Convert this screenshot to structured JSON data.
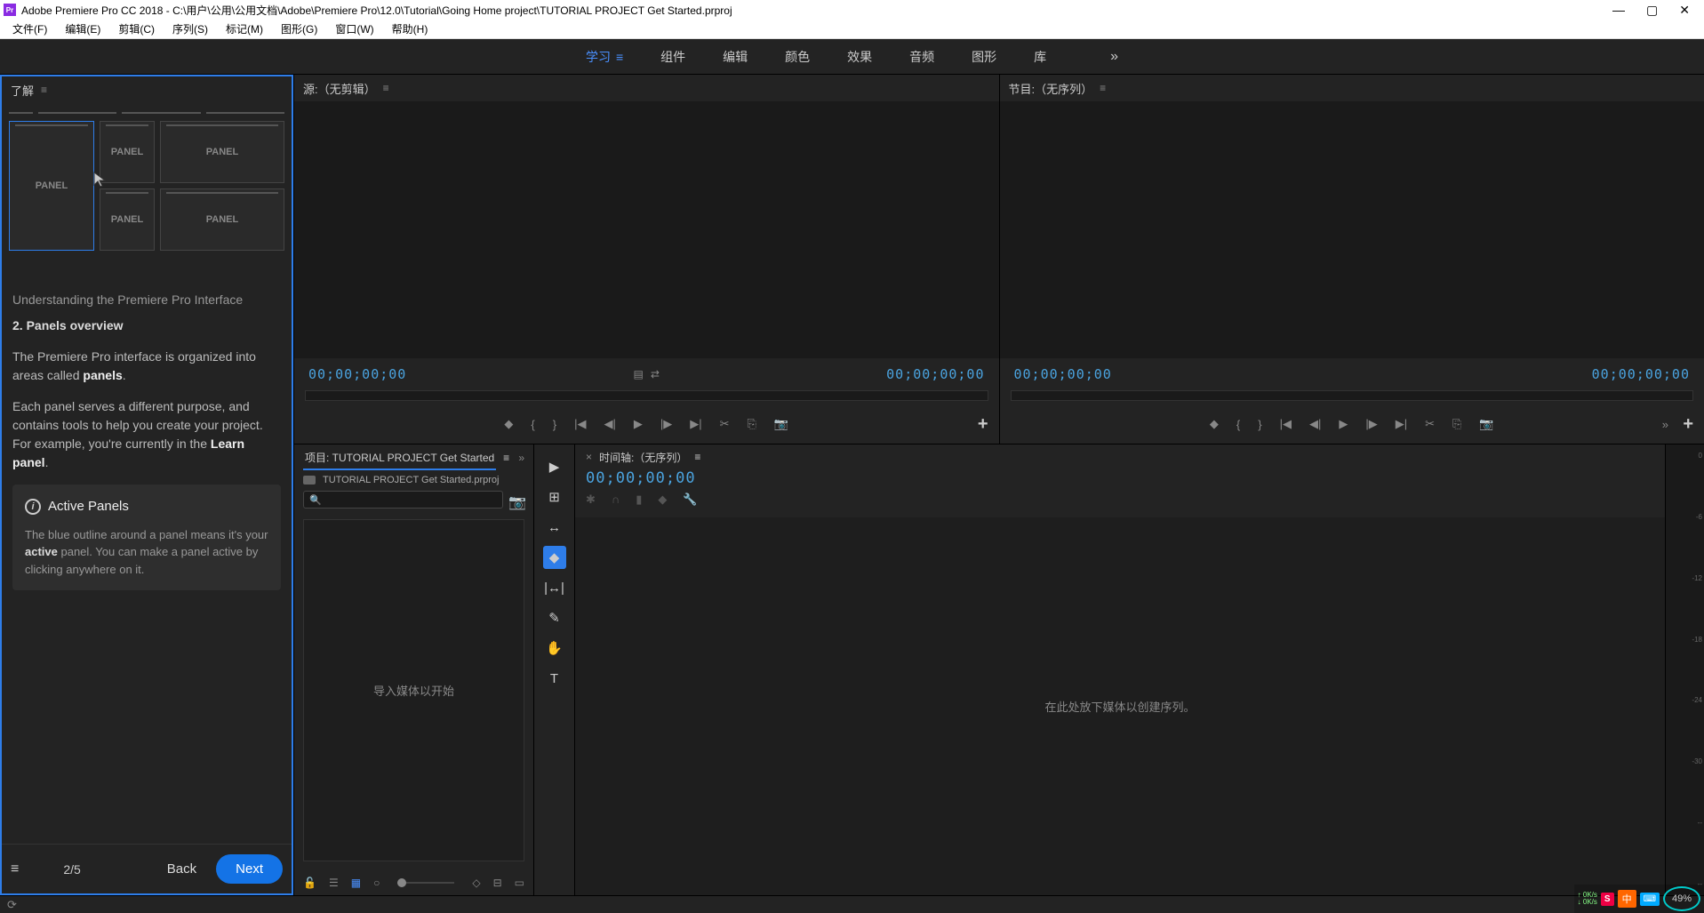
{
  "titlebar": {
    "app_icon_text": "Pr",
    "title": "Adobe Premiere Pro CC 2018 - C:\\用户\\公用\\公用文档\\Adobe\\Premiere Pro\\12.0\\Tutorial\\Going Home project\\TUTORIAL PROJECT Get Started.prproj",
    "minimize": "—",
    "maximize": "▢",
    "close": "✕"
  },
  "menubar": {
    "items": [
      "文件(F)",
      "编辑(E)",
      "剪辑(C)",
      "序列(S)",
      "标记(M)",
      "图形(G)",
      "窗口(W)",
      "帮助(H)"
    ]
  },
  "workspaces": {
    "items": [
      {
        "label": "学习",
        "active": true
      },
      {
        "label": "组件",
        "active": false
      },
      {
        "label": "编辑",
        "active": false
      },
      {
        "label": "颜色",
        "active": false
      },
      {
        "label": "效果",
        "active": false
      },
      {
        "label": "音频",
        "active": false
      },
      {
        "label": "图形",
        "active": false
      },
      {
        "label": "库",
        "active": false
      }
    ],
    "overflow": "»"
  },
  "learn": {
    "tab_title": "了解",
    "thumbs": [
      "PANEL",
      "PANEL",
      "PANEL",
      "PANEL",
      "PANEL"
    ],
    "subtitle1": "Understanding the Premiere Pro Interface",
    "subtitle2": "2. Panels overview",
    "para1_a": "The Premiere Pro interface is organized into areas called ",
    "para1_b": "panels",
    "para1_c": ".",
    "para2_a": "Each panel serves a different purpose, and contains tools to help you create your project. For example, you're currently in the ",
    "para2_b": "Learn panel",
    "para2_c": ".",
    "info_title": "Active Panels",
    "info_text_a": "The blue outline around a panel means it's your ",
    "info_text_b": "active",
    "info_text_c": " panel. You can make a panel active by clicking anywhere on it.",
    "counter": "2/5",
    "back": "Back",
    "next": "Next"
  },
  "source_monitor": {
    "tab": "源:（无剪辑）",
    "tc_left": "00;00;00;00",
    "tc_right": "00;00;00;00"
  },
  "program_monitor": {
    "tab": "节目:（无序列）",
    "tc_left": "00;00;00;00",
    "tc_right": "00;00;00;00"
  },
  "transport_icons": [
    "◆",
    "{",
    "}",
    "|◀",
    "◀|",
    "▶",
    "|▶",
    "▶|",
    "✂",
    "⎘",
    "📷"
  ],
  "project": {
    "tab": "项目: TUTORIAL PROJECT Get Started",
    "filename": "TUTORIAL PROJECT Get Started.prproj",
    "search_placeholder": "",
    "empty_text": "导入媒体以开始"
  },
  "tools": [
    {
      "name": "selection-tool",
      "glyph": "▶",
      "active": false
    },
    {
      "name": "track-select-tool",
      "glyph": "⊞",
      "active": false
    },
    {
      "name": "ripple-edit-tool",
      "glyph": "↔",
      "active": false
    },
    {
      "name": "razor-tool",
      "glyph": "◆",
      "active": true
    },
    {
      "name": "slip-tool",
      "glyph": "|↔|",
      "active": false
    },
    {
      "name": "pen-tool",
      "glyph": "✎",
      "active": false
    },
    {
      "name": "hand-tool",
      "glyph": "✋",
      "active": false
    },
    {
      "name": "type-tool",
      "glyph": "T",
      "active": false
    }
  ],
  "timeline": {
    "tab": "时间轴:（无序列）",
    "tc": "00;00;00;00",
    "empty_text": "在此处放下媒体以创建序列。"
  },
  "meters": {
    "scale": [
      "0",
      "-6",
      "-12",
      "-18",
      "-24",
      "-30",
      "--",
      "--"
    ]
  },
  "systray": {
    "up": "↑ 0K/s",
    "down": "↓ 0K/s",
    "perf": "49%",
    "ime_s": "S",
    "ime_cn": "中",
    "ime_kb": "⌨"
  }
}
